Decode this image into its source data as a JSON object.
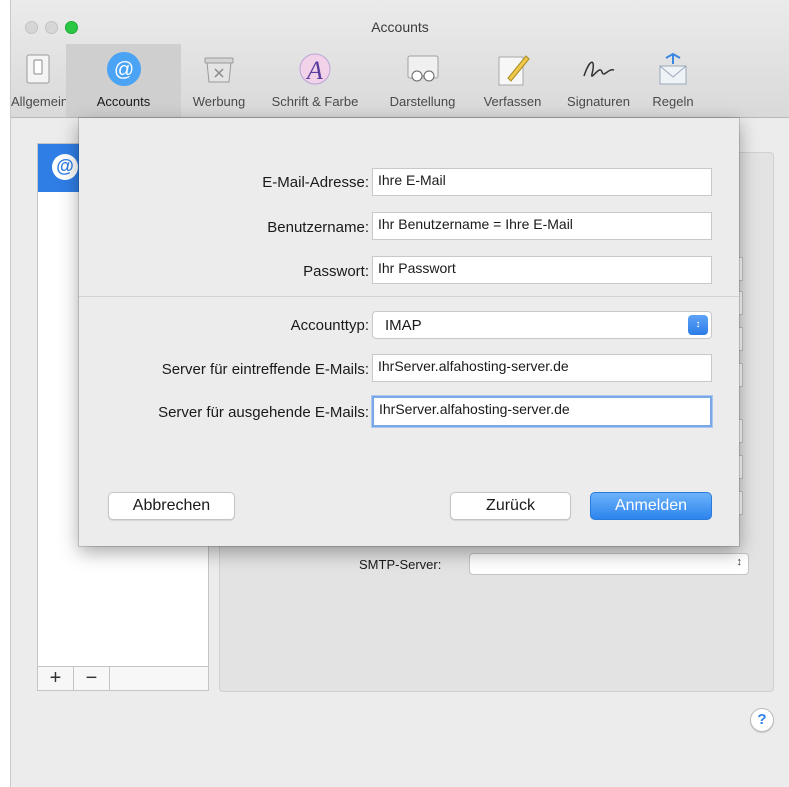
{
  "window": {
    "title": "Accounts"
  },
  "toolbar": {
    "items": [
      {
        "label": "Allgemein",
        "icon": "switch-icon"
      },
      {
        "label": "Accounts",
        "icon": "at-icon",
        "active": true
      },
      {
        "label": "Werbung",
        "icon": "junk-trash-icon"
      },
      {
        "label": "Schrift & Farbe",
        "icon": "font-color-icon"
      },
      {
        "label": "Darstellung",
        "icon": "glasses-icon"
      },
      {
        "label": "Verfassen",
        "icon": "pencil-icon"
      },
      {
        "label": "Signaturen",
        "icon": "signature-icon"
      },
      {
        "label": "Regeln",
        "icon": "rules-envelope-icon"
      }
    ]
  },
  "sidebar": {
    "add_label": "+",
    "remove_label": "−"
  },
  "background": {
    "smtp_label": "SMTP-Server:",
    "help_label": "?"
  },
  "sheet": {
    "email_label": "E-Mail-Adresse:",
    "email_value": "Ihre E-Mail",
    "username_label": "Benutzername:",
    "username_value": "Ihr Benutzername = Ihre E-Mail",
    "password_label": "Passwort:",
    "password_value": "Ihr Passwort",
    "account_type_label": "Accounttyp:",
    "account_type_value": "IMAP",
    "incoming_label": "Server für eintreffende E-Mails:",
    "incoming_value": "IhrServer.alfahosting-server.de",
    "outgoing_label": "Server für ausgehende E-Mails:",
    "outgoing_value": "IhrServer.alfahosting-server.de",
    "cancel_label": "Abbrechen",
    "back_label": "Zurück",
    "signin_label": "Anmelden"
  },
  "colors": {
    "accent": "#2f7ee6",
    "zoom": "#2ac845"
  }
}
